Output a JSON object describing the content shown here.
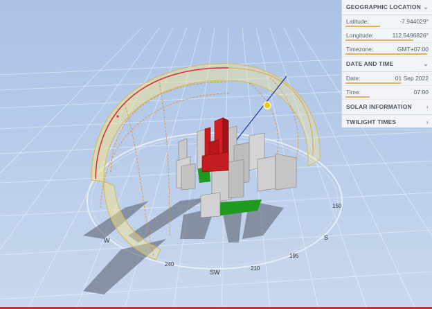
{
  "panel": {
    "geographic": {
      "title": "GEOGRAPHIC LOCATION",
      "latitude_label": "Latitude:",
      "latitude_value": "-7.944029°",
      "longitude_label": "Longitude:",
      "longitude_value": "112.5496826°",
      "timezone_label": "Timezone:",
      "timezone_value": "GMT+07:00"
    },
    "datetime": {
      "title": "DATE AND TIME",
      "date_label": "Date:",
      "date_value": "01 Sep 2022",
      "time_label": "Time:",
      "time_value": "07:00"
    },
    "solar": {
      "title": "SOLAR INFORMATION"
    },
    "twilight": {
      "title": "TWILIGHT TIMES"
    },
    "chevron_up": "⌄",
    "chevron_right": "›"
  },
  "compass": {
    "labels": [
      "W",
      "SW",
      "S",
      "240",
      "210",
      "195",
      "150"
    ]
  },
  "colors": {
    "sky": "#b9cdea",
    "grid": "#ffffff",
    "sun": "#f3c623",
    "sunpath_red": "#d62d2d",
    "selected_building": "#c8191e",
    "ground_green": "#1f9a1f"
  }
}
